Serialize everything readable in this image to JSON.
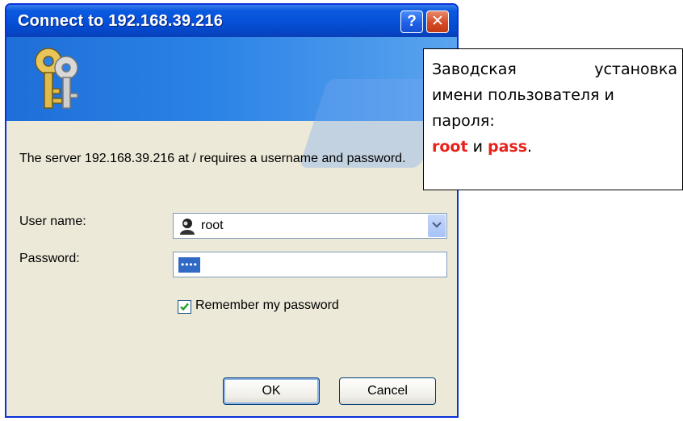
{
  "window": {
    "title": "Connect to 192.168.39.216",
    "help_label": "?",
    "close_label": "✕"
  },
  "dialog": {
    "message": "The server 192.168.39.216 at / requires a username and password.",
    "username_label": "User name:",
    "username_value": "root",
    "password_label": "Password:",
    "password_value": "••••",
    "remember_label": "Remember my password",
    "remember_checked": true,
    "ok_label": "OK",
    "cancel_label": "Cancel"
  },
  "callout": {
    "word1": "Заводская",
    "word2": "установка",
    "line2": "имени пользователя и",
    "line3": "пароля:",
    "user": "root",
    "conj": " и ",
    "pass": "pass",
    "period": "."
  },
  "colors": {
    "titlebar": "#0651d8",
    "highlight_red": "#e8211a",
    "selection": "#316ac5"
  },
  "icons": [
    "keys-icon",
    "help-icon",
    "close-icon",
    "user-icon",
    "dropdown-arrow-icon",
    "checkmark-icon"
  ]
}
